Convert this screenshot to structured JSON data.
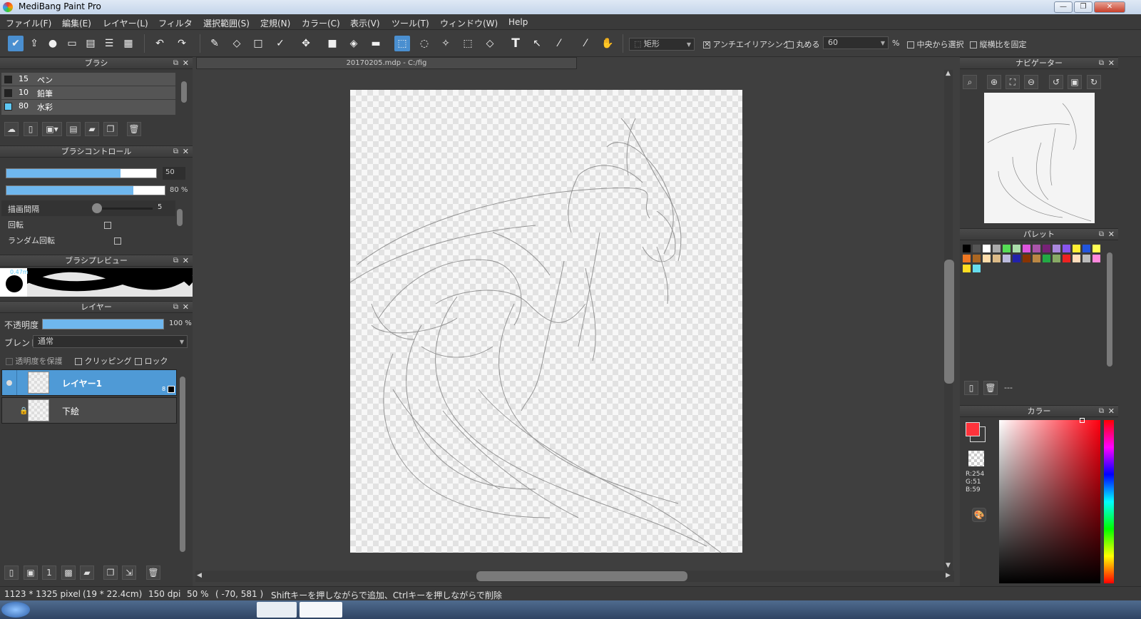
{
  "window": {
    "title": "MediBang Paint Pro",
    "minimize": "—",
    "maximize": "❐",
    "close": "✕"
  },
  "menu": [
    "ファイル(F)",
    "編集(E)",
    "レイヤー(L)",
    "フィルタ",
    "選択範囲(S)",
    "定規(N)",
    "カラー(C)",
    "表示(V)",
    "ツール(T)",
    "ウィンドウ(W)",
    "Help"
  ],
  "toolbar": {
    "shape_value": "矩形",
    "antialias_label": "アンチエイリアシング",
    "antialias_checked": true,
    "round_label": "丸める",
    "round_value": "60",
    "percent": "%",
    "center_select_label": "中央から選択",
    "fix_ratio_label": "縦横比を固定"
  },
  "document_tab": "20170205.mdp - C:/fig",
  "brush_panel": {
    "title": "ブラシ",
    "items": [
      {
        "size": "15",
        "name": "ペン",
        "color": "#222222"
      },
      {
        "size": "10",
        "name": "鉛筆",
        "color": "#222222"
      },
      {
        "size": "80",
        "name": "水彩",
        "color": "#5ec8f5"
      }
    ]
  },
  "brush_control": {
    "title": "ブラシコントロール",
    "size_value": "50",
    "size_fraction": 0.76,
    "opacity_value": "80 %",
    "opacity_fraction": 0.8,
    "interval_label": "描画間隔",
    "interval_value": "5",
    "rotate_label": "回転",
    "random_rotate_label": "ランダム回転"
  },
  "brush_preview": {
    "title": "ブラシプレビュー",
    "size_text": "0.47m"
  },
  "layer_panel": {
    "title": "レイヤー",
    "opacity_label": "不透明度",
    "opacity_value": "100 %",
    "opacity_fraction": 1.0,
    "blend_label": "ブレンド",
    "blend_value": "通常",
    "protect_alpha_label": "透明度を保護",
    "clipping_label": "クリッピング",
    "lock_label": "ロック",
    "layers": [
      {
        "name": "レイヤー1",
        "badge": "8",
        "selected": true
      },
      {
        "name": "下絵",
        "badge": "",
        "selected": false
      }
    ]
  },
  "navigator": {
    "title": "ナビゲーター"
  },
  "palette": {
    "title": "パレット",
    "page_text": "---",
    "colors": [
      "#000000",
      "#555555",
      "#ffffff",
      "#aaaaaa",
      "#55dd55",
      "#aaddaa",
      "#dd55dd",
      "#aa55aa",
      "#772277",
      "#aa88dd",
      "#8855ee",
      "#ffee33",
      "#2255dd",
      "#ffff55",
      "#ee7722",
      "#aa6622",
      "#ffddaa",
      "#ddbb88",
      "#bbbbdd",
      "#2222aa",
      "#883300",
      "#bb8844",
      "#22aa44",
      "#88aa66",
      "#ee2222",
      "#ffddbb",
      "#bbbbbb",
      "#ff88dd",
      "#ffdd22",
      "#66ddee"
    ]
  },
  "color_panel": {
    "title": "カラー",
    "primary": "#fe333b",
    "r": "R:254",
    "g": "G:51",
    "b": "B:59"
  },
  "status": {
    "size": "1123 * 1325 pixel",
    "cm": "(19 * 22.4cm)",
    "dpi": "150 dpi",
    "zoom": "50 %",
    "coords": "( -70, 581 )",
    "hint": "Shiftキーを押しながらで追加、Ctrlキーを押しながらで削除"
  }
}
